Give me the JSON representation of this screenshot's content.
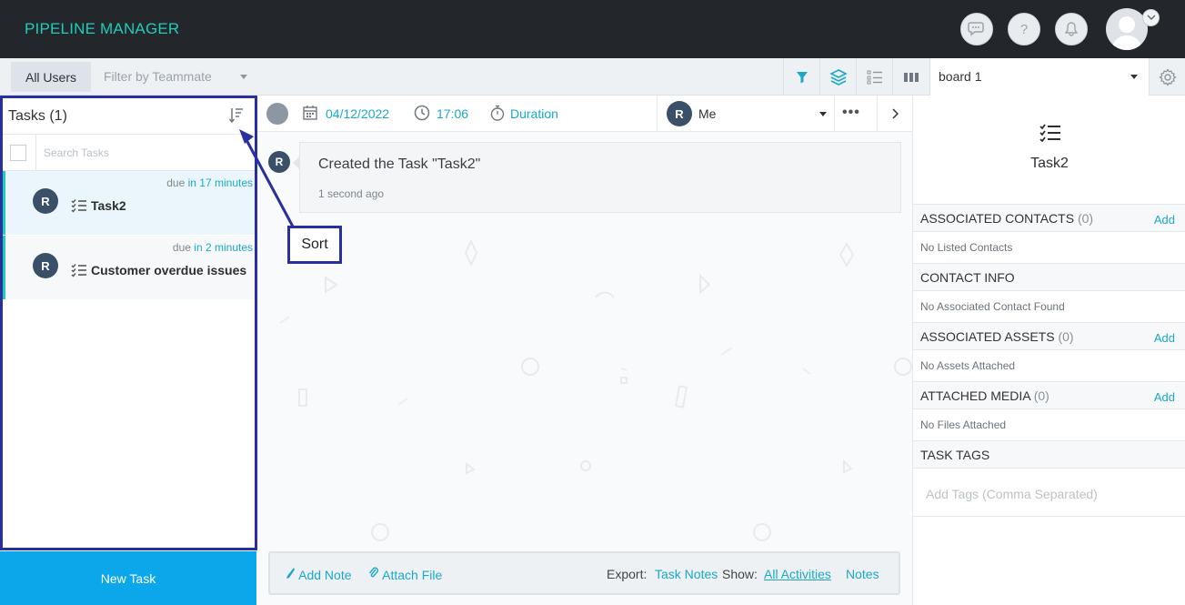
{
  "app": {
    "brand": "PIPELINE MANAGER"
  },
  "toolbar": {
    "all_users": "All Users",
    "filter_teammate": "Filter by Teammate",
    "board_select": "board 1"
  },
  "tasks_panel": {
    "title": "Tasks (1)",
    "search_placeholder": "Search Tasks",
    "items": [
      {
        "avatar": "R",
        "due_prefix": "due",
        "due_rel": "in 17 minutes",
        "name": "Task2"
      },
      {
        "avatar": "R",
        "due_prefix": "due",
        "due_rel": "in 2 minutes",
        "name": "Customer overdue issues"
      }
    ],
    "new_task": "New Task"
  },
  "task_header": {
    "date": "04/12/2022",
    "time": "17:06",
    "duration": "Duration",
    "assignee_avatar": "R",
    "assignee": "Me"
  },
  "activity": {
    "avatar": "R",
    "text": "Created the Task \"Task2\"",
    "time": "1 second ago"
  },
  "bottom_bar": {
    "add_note": "Add Note",
    "attach_file": "Attach File",
    "export_label": "Export:",
    "task_notes": "Task Notes",
    "show_label": "Show:",
    "all_activities": "All Activities",
    "notes": "Notes"
  },
  "callout": {
    "label": "Sort"
  },
  "right_panel": {
    "title": "Task2",
    "sections": [
      {
        "title": "ASSOCIATED CONTACTS",
        "count": "(0)",
        "add": "Add",
        "body": "No Listed Contacts"
      },
      {
        "title": "CONTACT INFO",
        "count": "",
        "add": "",
        "body": "No Associated Contact Found"
      },
      {
        "title": "ASSOCIATED ASSETS",
        "count": "(0)",
        "add": "Add",
        "body": "No Assets Attached"
      },
      {
        "title": "ATTACHED MEDIA",
        "count": "(0)",
        "add": "Add",
        "body": "No Files Attached"
      },
      {
        "title": "TASK TAGS",
        "count": "",
        "add": "",
        "body": ""
      }
    ],
    "tags_placeholder": "Add Tags (Comma Separated)"
  },
  "colors": {
    "brand": "#1fcdbb",
    "accent": "#1aa8c9",
    "primary_button": "#0ba7ea",
    "callout": "#2a2fa0",
    "topbar": "#23262b"
  },
  "icons": [
    "chat-icon",
    "help-icon",
    "bell-icon",
    "user-avatar-icon",
    "filter-icon",
    "layers-icon",
    "list-icon",
    "columns-icon",
    "gear-icon",
    "sort-icon",
    "calendar-icon",
    "clock-icon",
    "stopwatch-icon",
    "task-list-icon",
    "pen-icon",
    "paperclip-icon"
  ]
}
